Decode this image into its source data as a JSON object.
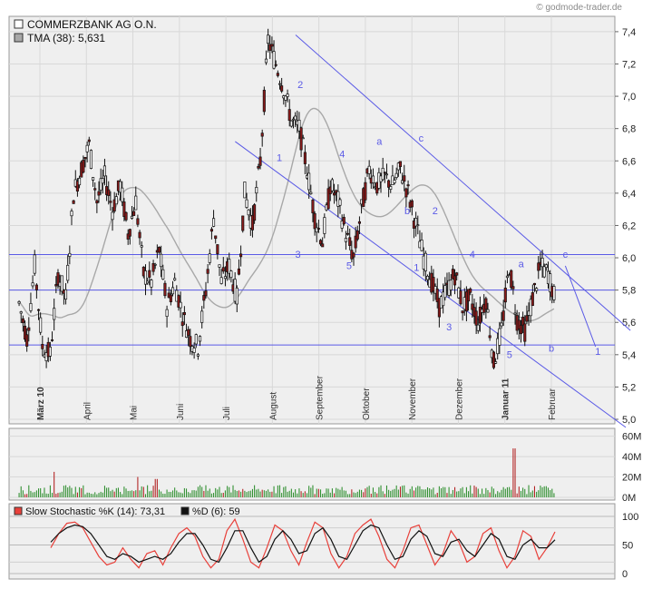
{
  "watermark": "© godmode-trader.de",
  "colors": {
    "up_candle": "#ffffff",
    "down_candle": "#8b1a1a",
    "tma_line": "#a8a8a8",
    "trend_line": "#5a5ae6",
    "volume_bar": "#2f8f2f",
    "volume_bar_highlight": "#b22222",
    "stoch_k": "#e8403a",
    "stoch_d": "#111111",
    "panel_bg": "#efefef",
    "grid": "#d8d8d8"
  },
  "chart_data": [
    {
      "type": "candlestick",
      "panel": "price",
      "legend": [
        {
          "label": "COMMERZBANK AG O.N.",
          "swatch": "#ffffff"
        },
        {
          "label": "TMA (38): 5,631",
          "swatch": "#a8a8a8"
        }
      ],
      "ylim": [
        5.0,
        7.45
      ],
      "yticks": [
        "5,0",
        "5,2",
        "5,4",
        "5,6",
        "5,8",
        "6,0",
        "6,2",
        "6,4",
        "6,6",
        "6,8",
        "7,0",
        "7,2",
        "7,4"
      ],
      "ytick_values": [
        5.0,
        5.2,
        5.4,
        5.6,
        5.8,
        6.0,
        6.2,
        6.4,
        6.6,
        6.8,
        7.0,
        7.2,
        7.4
      ],
      "x_months": [
        {
          "label": "März 10",
          "bold": true
        },
        {
          "label": "April",
          "bold": false
        },
        {
          "label": "Mai",
          "bold": false
        },
        {
          "label": "Juni",
          "bold": false
        },
        {
          "label": "Juli",
          "bold": false
        },
        {
          "label": "August",
          "bold": false
        },
        {
          "label": "September",
          "bold": false
        },
        {
          "label": "Oktober",
          "bold": false
        },
        {
          "label": "November",
          "bold": false
        },
        {
          "label": "Dezember",
          "bold": false
        },
        {
          "label": "Januar 11",
          "bold": true
        },
        {
          "label": "Februar",
          "bold": false
        }
      ],
      "close_path": [
        5.72,
        5.5,
        5.95,
        5.45,
        5.4,
        5.9,
        5.75,
        6.4,
        6.55,
        6.7,
        6.35,
        6.5,
        6.3,
        6.45,
        6.15,
        6.35,
        5.9,
        5.85,
        6.05,
        5.7,
        5.85,
        5.65,
        5.5,
        5.45,
        5.8,
        6.25,
        5.85,
        5.95,
        5.75,
        6.4,
        6.2,
        6.6,
        7.35,
        7.2,
        7.05,
        6.85,
        6.8,
        6.55,
        6.25,
        6.1,
        6.45,
        6.35,
        6.15,
        6.0,
        6.3,
        6.55,
        6.45,
        6.5,
        6.45,
        6.55,
        6.4,
        6.2,
        6.0,
        5.85,
        5.7,
        5.8,
        5.9,
        5.7,
        5.75,
        5.6,
        5.75,
        5.35,
        5.55,
        5.95,
        5.62,
        5.55,
        5.75,
        5.95,
        5.9,
        5.72
      ],
      "horizontal_levels": [
        6.02,
        5.8,
        5.46
      ],
      "trend_lines": [
        {
          "from": {
            "month_pos": 5.5,
            "price": 7.38
          },
          "to": {
            "month_pos": 12.7,
            "price": 5.55
          }
        },
        {
          "from": {
            "month_pos": 4.2,
            "price": 6.72
          },
          "to": {
            "month_pos": 12.6,
            "price": 4.95
          }
        },
        {
          "from": {
            "month_pos": 11.3,
            "price": 5.95
          },
          "to": {
            "month_pos": 11.95,
            "price": 5.45
          }
        }
      ],
      "wave_labels": [
        {
          "text": "1",
          "month_pos": 5.15,
          "price": 6.6
        },
        {
          "text": "2",
          "month_pos": 5.6,
          "price": 7.05
        },
        {
          "text": "3",
          "month_pos": 5.55,
          "price": 6.0
        },
        {
          "text": "4",
          "month_pos": 6.5,
          "price": 6.62
        },
        {
          "text": "5",
          "month_pos": 6.65,
          "price": 5.93
        },
        {
          "text": "a",
          "month_pos": 7.3,
          "price": 6.7
        },
        {
          "text": "b",
          "month_pos": 7.9,
          "price": 6.27
        },
        {
          "text": "c",
          "month_pos": 8.2,
          "price": 6.72
        },
        {
          "text": "2",
          "month_pos": 8.5,
          "price": 6.27
        },
        {
          "text": "1",
          "month_pos": 8.1,
          "price": 5.92
        },
        {
          "text": "4",
          "month_pos": 9.3,
          "price": 6.0
        },
        {
          "text": "3",
          "month_pos": 8.8,
          "price": 5.55
        },
        {
          "text": "a",
          "month_pos": 10.35,
          "price": 5.94
        },
        {
          "text": "5",
          "month_pos": 10.1,
          "price": 5.38
        },
        {
          "text": "c",
          "month_pos": 11.3,
          "price": 6.0
        },
        {
          "text": "b",
          "month_pos": 11.0,
          "price": 5.42
        },
        {
          "text": "1",
          "month_pos": 12.0,
          "price": 5.4
        }
      ]
    },
    {
      "type": "bar",
      "panel": "volume",
      "ylim": [
        0,
        65
      ],
      "yticks": [
        "0M",
        "20M",
        "40M",
        "60M"
      ],
      "ytick_values": [
        0,
        20,
        40,
        60
      ],
      "spikes": [
        {
          "month_pos": 0.3,
          "value": 25
        },
        {
          "month_pos": 2.1,
          "value": 20
        },
        {
          "month_pos": 2.5,
          "value": 18
        },
        {
          "month_pos": 10.2,
          "value": 48
        }
      ],
      "typical_range": [
        3,
        12
      ]
    },
    {
      "type": "line",
      "panel": "stochastic",
      "legend": [
        {
          "label": "Slow Stochastic %K (14): 73,31",
          "swatch": "#e8403a"
        },
        {
          "label": "%D (6): 59",
          "swatch": "#111111"
        }
      ],
      "ylim": [
        0,
        100
      ],
      "yticks": [
        "0",
        "50",
        "100"
      ],
      "ytick_values": [
        0,
        50,
        100
      ],
      "k_values": [
        45,
        70,
        88,
        90,
        80,
        55,
        30,
        15,
        20,
        45,
        25,
        10,
        35,
        40,
        15,
        45,
        70,
        80,
        65,
        30,
        10,
        25,
        75,
        95,
        60,
        20,
        10,
        45,
        85,
        75,
        40,
        15,
        55,
        90,
        80,
        35,
        10,
        30,
        70,
        85,
        95,
        65,
        25,
        10,
        40,
        80,
        85,
        50,
        15,
        35,
        75,
        55,
        20,
        30,
        70,
        80,
        40,
        10,
        30,
        75,
        65,
        25,
        45,
        73
      ],
      "d_values": [
        55,
        70,
        80,
        85,
        82,
        70,
        50,
        30,
        25,
        35,
        30,
        20,
        25,
        30,
        25,
        35,
        55,
        70,
        70,
        50,
        25,
        20,
        45,
        75,
        75,
        45,
        20,
        30,
        60,
        75,
        60,
        35,
        40,
        70,
        80,
        60,
        30,
        25,
        50,
        75,
        85,
        80,
        50,
        25,
        30,
        60,
        75,
        65,
        35,
        30,
        55,
        60,
        40,
        30,
        50,
        70,
        60,
        30,
        25,
        50,
        60,
        45,
        45,
        59
      ]
    }
  ]
}
